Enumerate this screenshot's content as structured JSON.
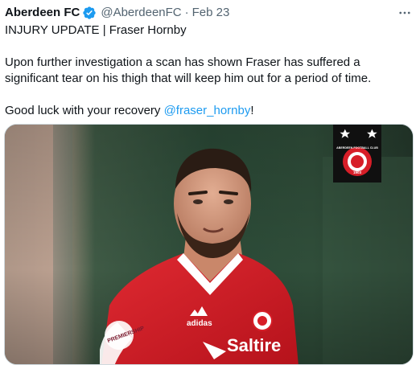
{
  "tweet": {
    "author": {
      "display_name": "Aberdeen FC",
      "handle": "@AberdeenFC",
      "verified": true
    },
    "separator": "·",
    "date": "Feb 23",
    "body": {
      "headline": "INJURY UPDATE | Fraser Hornby",
      "paragraph": "Upon further investigation a scan has shown Fraser has suffered a significant tear on his thigh that will keep him out for a period of time.",
      "closing_prefix": "Good luck with your recovery ",
      "mention": "@fraser_hornby",
      "closing_suffix": "!"
    },
    "media": {
      "badge_text": "ABERDEEN FOOTBALL CLUB",
      "badge_year": "1903",
      "shirt_sponsor": "Saltire",
      "shirt_brand": "adidas",
      "sleeve_text": "PREMIERSHIP"
    }
  },
  "colors": {
    "text": "#0f1419",
    "muted": "#536471",
    "link": "#1d9bf0",
    "verified": "#1d9bf0",
    "club_red": "#d71e28"
  },
  "icons": {
    "verified": "verified-badge-icon",
    "more": "more-dots-icon"
  }
}
